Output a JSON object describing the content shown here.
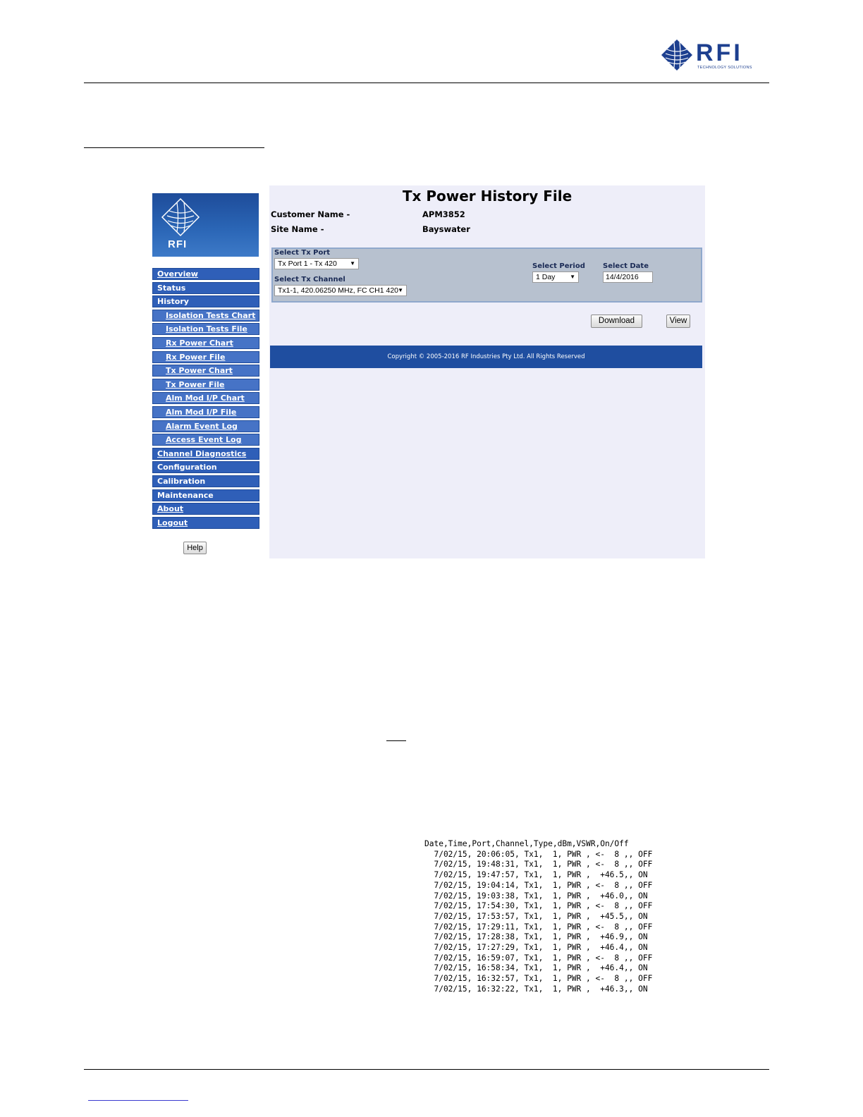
{
  "brand": {
    "name": "RFI",
    "tagline": "TECHNOLOGY SOLUTIONS"
  },
  "app": {
    "logo_text": "RFI",
    "title": "Tx Power History File",
    "customer": {
      "label": "Customer Name -",
      "value": "APM3852"
    },
    "site": {
      "label": "Site Name -",
      "value": "Bayswater"
    },
    "selectors": {
      "tx_port": {
        "label": "Select Tx Port",
        "value": "Tx Port 1 - Tx 420"
      },
      "tx_channel": {
        "label": "Select Tx Channel",
        "value": "Tx1-1, 420.06250 MHz, FC CH1 420"
      },
      "period": {
        "label": "Select Period",
        "value": "1 Day"
      },
      "date": {
        "label": "Select Date",
        "value": "14/4/2016"
      }
    },
    "buttons": {
      "download": "Download",
      "view": "View",
      "help": "Help"
    },
    "copyright": "Copyright © 2005-2016 RF Industries Pty Ltd. All Rights Reserved",
    "nav": [
      {
        "label": "Overview"
      },
      {
        "label": "Status"
      },
      {
        "label": "History"
      },
      {
        "label": "Isolation Tests Chart"
      },
      {
        "label": "Isolation Tests File"
      },
      {
        "label": "Rx Power Chart"
      },
      {
        "label": "Rx Power File"
      },
      {
        "label": "Tx Power Chart"
      },
      {
        "label": "Tx Power File"
      },
      {
        "label": "Alm Mod I/P Chart"
      },
      {
        "label": "Alm Mod I/P File"
      },
      {
        "label": "Alarm Event Log"
      },
      {
        "label": "Access Event Log"
      },
      {
        "label": "Channel Diagnostics"
      },
      {
        "label": "Configuration"
      },
      {
        "label": "Calibration"
      },
      {
        "label": "Maintenance"
      },
      {
        "label": "About"
      },
      {
        "label": "Logout"
      }
    ]
  },
  "csv": {
    "header": "Date,Time,Port,Channel,Type,dBm,VSWR,On/Off",
    "rows": [
      "  7/02/15, 20:06:05, Tx1,  1, PWR , <-  8 ,, OFF",
      "  7/02/15, 19:48:31, Tx1,  1, PWR , <-  8 ,, OFF",
      "  7/02/15, 19:47:57, Tx1,  1, PWR ,  +46.5,, ON",
      "  7/02/15, 19:04:14, Tx1,  1, PWR , <-  8 ,, OFF",
      "  7/02/15, 19:03:38, Tx1,  1, PWR ,  +46.0,, ON",
      "  7/02/15, 17:54:30, Tx1,  1, PWR , <-  8 ,, OFF",
      "  7/02/15, 17:53:57, Tx1,  1, PWR ,  +45.5,, ON",
      "  7/02/15, 17:29:11, Tx1,  1, PWR , <-  8 ,, OFF",
      "  7/02/15, 17:28:38, Tx1,  1, PWR ,  +46.9,, ON",
      "  7/02/15, 17:27:29, Tx1,  1, PWR ,  +46.4,, ON",
      "  7/02/15, 16:59:07, Tx1,  1, PWR , <-  8 ,, OFF",
      "  7/02/15, 16:58:34, Tx1,  1, PWR ,  +46.4,, ON",
      "  7/02/15, 16:32:57, Tx1,  1, PWR , <-  8 ,, OFF",
      "  7/02/15, 16:32:22, Tx1,  1, PWR ,  +46.3,, ON"
    ]
  }
}
